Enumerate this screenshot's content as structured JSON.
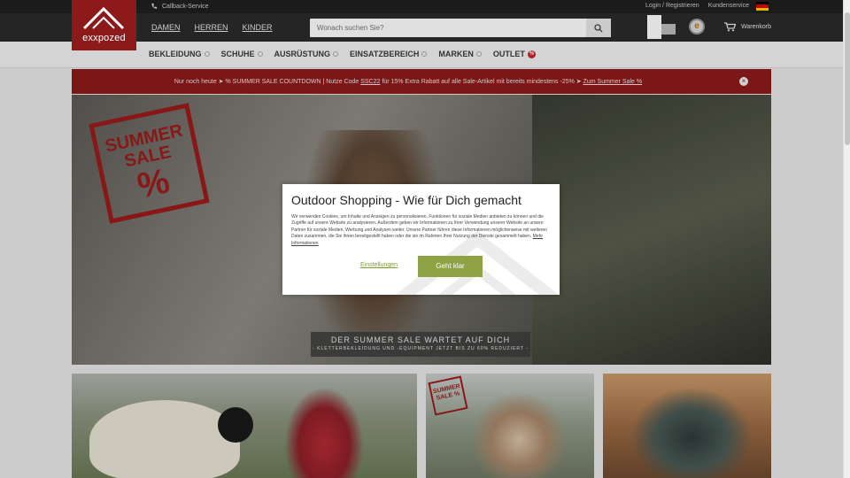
{
  "topbar": {
    "callback_label": "Callback-Service",
    "login_label": "Login / Registrieren",
    "service_label": "Kundenservice"
  },
  "header": {
    "brand": "exxpozed",
    "gender_nav": [
      "DAMEN",
      "HERREN",
      "KINDER"
    ],
    "search_placeholder": "Wonach suchen Sie?",
    "cart_label": "Warenkorb"
  },
  "main_nav": {
    "items": [
      "BEKLEIDUNG",
      "SCHUHE",
      "AUSRÜSTUNG",
      "EINSATZBEREICH",
      "MARKEN",
      "OUTLET"
    ],
    "outlet_badge": "%"
  },
  "promo": {
    "text_part1": "Nur noch heute ➤ % SUMMER SALE COUNTDOWN | Nutze Code ",
    "code": "SSC22",
    "text_part2": " für 15% Extra Rabatt auf alle Sale-Artikel mit bereits mindestens -25% ➤ ",
    "link": "Zum Summer Sale %",
    "close_label": "×"
  },
  "hero": {
    "stamp_text": "SUMMER SALE",
    "stamp_symbol": "%",
    "cta_headline": "DER SUMMER SALE WARTET AUF DICH",
    "cta_sub": "- KLETTERBEKLEIDUNG UND -EQUIPMENT JETZT BIS ZU 60% REDUZIERT -"
  },
  "tiles": {
    "tile2_stamp": "SUMMER SALE %"
  },
  "cookie_modal": {
    "title": "Outdoor Shopping - Wie für Dich gemacht",
    "body": "Wir verwenden Cookies, um Inhalte und Anzeigen zu personalisieren, Funktionen für soziale Medien anbieten zu können und die Zugriffe auf unsere Website zu analysieren. Außerdem geben wir Informationen zu Ihrer Verwendung unserer Website an unsere Partner für soziale Medien, Werbung und Analysen weiter. Unsere Partner führen diese Informationen möglicherweise mit weiteren Daten zusammen, die Sie ihnen bereitgestellt haben oder die sie im Rahmen Ihrer Nutzung der Dienste gesammelt haben.",
    "more_info": "Mehr Informationen",
    "settings_label": "Einstellungen",
    "accept_label": "Geht klar"
  },
  "colors": {
    "brand_red": "#8e1b1b",
    "accept_green": "#8fa245",
    "header_dark": "#2b2b2b"
  }
}
